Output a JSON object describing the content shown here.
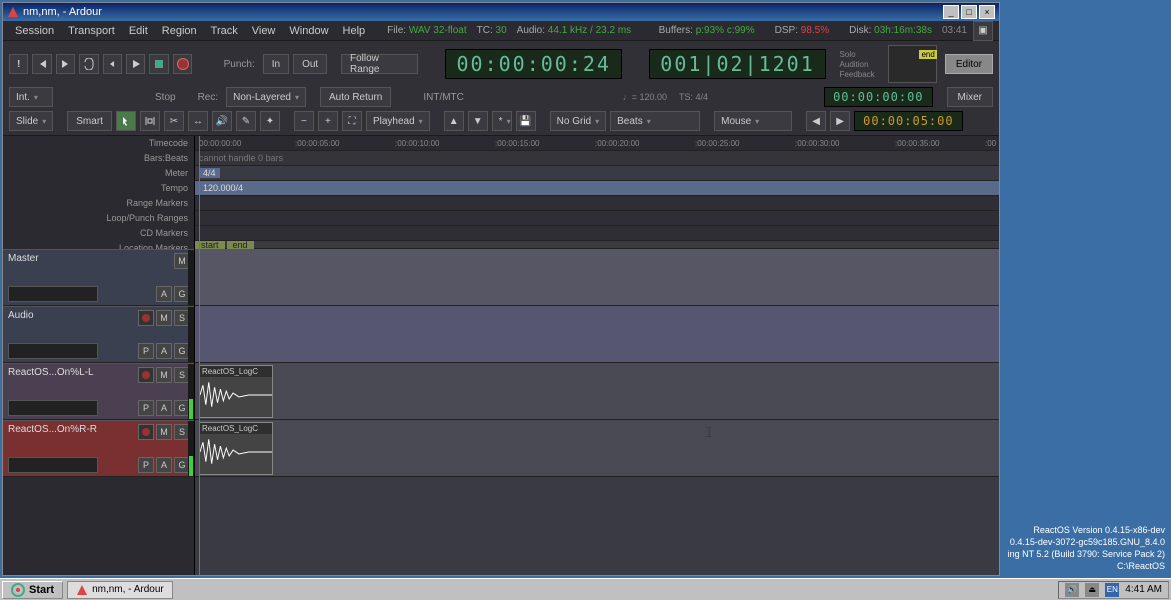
{
  "titlebar": {
    "title": "nm,nm, - Ardour"
  },
  "menubar": {
    "items": [
      "Session",
      "Transport",
      "Edit",
      "Region",
      "Track",
      "View",
      "Window",
      "Help"
    ],
    "file_label": "File:",
    "file_value": "WAV 32-float",
    "tc_label": "TC:",
    "tc_value": "30",
    "audio_label": "Audio:",
    "audio_value": "44.1 kHz / 23.2 ms",
    "buffers_label": "Buffers:",
    "buffers_value": "p:93% c:99%",
    "dsp_label": "DSP:",
    "dsp_value": "98.5%",
    "disk_label": "Disk:",
    "disk_value": "03h:16m:38s",
    "clock": "03:41"
  },
  "toolbar": {
    "punch_label": "Punch:",
    "in": "In",
    "out": "Out",
    "follow_range": "Follow Range",
    "int": "Int.",
    "stop": "Stop",
    "rec_label": "Rec:",
    "non_layered": "Non-Layered",
    "auto_return": "Auto Return",
    "int_mtc": "INT/MTC",
    "big_clock": "00:00:00:24",
    "bbt_clock": "001|02|1201",
    "tempo_note": "♩= 120.00",
    "ts": "TS: 4/4",
    "side": {
      "solo": "Solo",
      "audition": "Audition",
      "feedback": "Feedback"
    },
    "mini_flag": "end",
    "small_clock": "00:00:00:00",
    "editor": "Editor",
    "mixer": "Mixer",
    "slide": "Slide",
    "smart": "Smart",
    "playhead": "Playhead",
    "no_grid": "No Grid",
    "beats": "Beats",
    "mouse": "Mouse",
    "sec_clock": "00:00:05:00"
  },
  "rulers": {
    "labels": [
      "Timecode",
      "Bars:Beats",
      "Meter",
      "Tempo",
      "Range Markers",
      "Loop/Punch Ranges",
      "CD Markers",
      "Location Markers"
    ],
    "timecode_ticks": [
      {
        "pos": 4,
        "label": "00:00:00:00"
      },
      {
        "pos": 100,
        "label": ":00:00:05:00"
      },
      {
        "pos": 200,
        "label": ":00:00:10:00"
      },
      {
        "pos": 300,
        "label": ":00:00:15:00"
      },
      {
        "pos": 400,
        "label": ":00:00:20:00"
      },
      {
        "pos": 500,
        "label": ":00:00:25:00"
      },
      {
        "pos": 600,
        "label": ":00:00:30:00"
      },
      {
        "pos": 700,
        "label": ":00:00:35:00"
      },
      {
        "pos": 790,
        "label": ":00"
      }
    ],
    "barsbeats_text": "cannot handle 0 bars",
    "meter_tag": "4/4",
    "tempo_tag": "120.000/4",
    "markers": {
      "start": "start",
      "end": "end"
    }
  },
  "tracks": [
    {
      "name": "Master",
      "kind": "master",
      "btns1": [
        "M"
      ],
      "btns2": [
        "A",
        "G"
      ]
    },
    {
      "name": "Audio",
      "kind": "audio",
      "btns1": [
        "●",
        "M",
        "S"
      ],
      "btns2": [
        "P",
        "A",
        "G"
      ]
    },
    {
      "name": "ReactOS...On%L-L",
      "kind": "left",
      "btns1": [
        "●",
        "M",
        "S"
      ],
      "btns2": [
        "P",
        "A",
        "G"
      ],
      "region": "ReactOS_LogC"
    },
    {
      "name": "ReactOS...On%R-R",
      "kind": "selected",
      "btns1": [
        "●",
        "M",
        "S"
      ],
      "btns2": [
        "P",
        "A",
        "G"
      ],
      "region": "ReactOS_LogC"
    }
  ],
  "taskbar": {
    "start": "Start",
    "task": "nm,nm, - Ardour",
    "time": "4:41 AM",
    "lang": "EN"
  },
  "watermark": {
    "l1": "ReactOS Version 0.4.15-x86-dev",
    "l2": "0.4.15-dev-3072-gc59c185.GNU_8.4.0",
    "l3": "ing NT 5.2 (Build 3790: Service Pack 2)",
    "l4": "C:\\ReactOS"
  }
}
